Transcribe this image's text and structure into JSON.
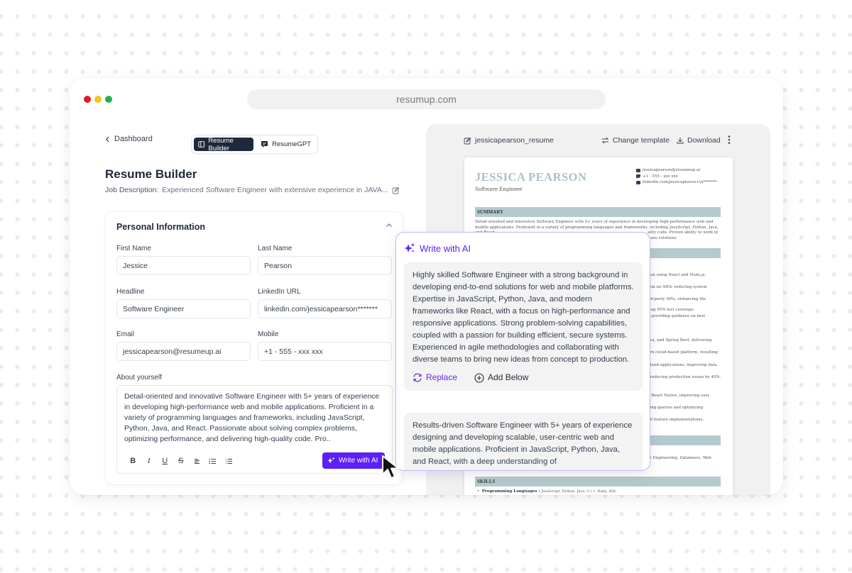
{
  "browser": {
    "url": "resumup.com",
    "traffic_lights": [
      "#e11d1d",
      "#f5c518",
      "#22b14c"
    ]
  },
  "builder": {
    "back_label": "Dashboard",
    "tabs": [
      {
        "label": "Resume Builder",
        "icon": "layout-panel-icon",
        "active": true
      },
      {
        "label": "ResumeGPT",
        "icon": "chat-bubble-icon",
        "active": false
      }
    ],
    "title": "Resume Builder",
    "job_description_label": "Job Description:",
    "job_description_value": "Experienced Software Engineer with extensive experience in JAVA..."
  },
  "personal_info": {
    "title": "Personal Information",
    "fields": {
      "first_name": {
        "label": "First Name",
        "value": "Jessice"
      },
      "last_name": {
        "label": "Last Name",
        "value": "Pearson"
      },
      "headline": {
        "label": "Headline",
        "value": "Software Engineer"
      },
      "linkedin": {
        "label": "LinkedIn URL",
        "value": "linkedin.com/jessicapearson*******"
      },
      "email": {
        "label": "Email",
        "value": "jessicapearson@resumeup.ai"
      },
      "mobile": {
        "label": "Mobile",
        "value": "+1 - 555 - xxx xxx"
      }
    },
    "about": {
      "label": "About yourself",
      "value": "Detail-oriented and innovative Software Engineer with 5+ years of experience in developing high-performance web and mobile applications. Proficient in a variety of programming languages and frameworks, including JavaScript, Python, Java, and React. Passionate about solving complex problems, optimizing performance, and delivering high-quality code. Pro.."
    },
    "format_tools": [
      "B",
      "I",
      "U",
      "S",
      "align",
      "bullet-list",
      "numbered-list"
    ],
    "write_ai_label": "Write with AI"
  },
  "preview": {
    "file_name": "jessicapearson_resume",
    "change_template_label": "Change template",
    "download_label": "Download",
    "resume": {
      "name": "JESSICA PEARSON",
      "title": "Software Engineer",
      "email": "jessicapearson@resumeup.ai",
      "phone": "+1 - 555 - xxx xxx",
      "linkedin": "linkedin.com/jessicapearso+\\n*******",
      "summary_heading": "SUMMARY",
      "summary_text": "Detail-oriented and innovative Software Engineer with 5+ years of experience in developing high-performance web and mobile applications. Proficient in a variety of programming languages and frameworks, including JavaScript, Python, Java, and React.",
      "summary_tail_1": "ality code. Proven ability to work in",
      "summary_tail_2": "ware solutions",
      "experience_fragments": [
        "tion using React and Node.js,",
        "tem on AWS, reducing system",
        "ird-party APIs, enhancing the",
        "ring 95% test coverage.",
        "d providing guidance on best",
        "ava, and Spring Boot, delivering",
        "ern cloud-based platform, resulting",
        "ntend applications, improving data",
        ", reducing production issues by 40%.",
        "g React Native, improving user",
        "ning queries and optimizing",
        "nd feature implementations."
      ],
      "education_fragment": "re Engineering, Databases, Web",
      "skills_heading": "SKILLS",
      "skills_item_label": "Programming Languages :",
      "skills_item_value": "JavaScript, Python, Java, C++, Ruby, SQL"
    }
  },
  "ai_popup": {
    "title": "Write with AI",
    "suggestions": [
      {
        "text": "Highly skilled Software Engineer with a strong background in developing end-to-end solutions for web and mobile platforms. Expertise in JavaScript, Python, Java, and modern frameworks like React, with a focus on high-performance and responsive applications. Strong problem-solving capabilities, coupled with a passion for building efficient, secure systems. Experienced in agile methodologies and collaborating with diverse teams to bring new ideas from concept to production.",
        "replace_label": "Replace",
        "add_below_label": "Add Below"
      },
      {
        "text": "Results-driven Software Engineer with 5+ years of experience designing and developing scalable, user-centric web and mobile applications. Proficient in JavaScript, Python, Java, and React, with a deep understanding of"
      }
    ]
  },
  "colors": {
    "accent": "#5b21f6",
    "resume_heading_bg": "#b5cacf",
    "resume_name": "#a9c2c6"
  }
}
